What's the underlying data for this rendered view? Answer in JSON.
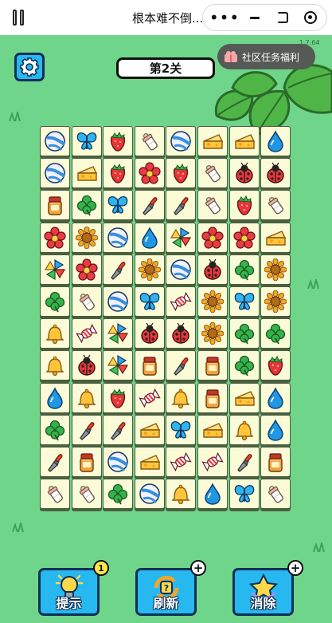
{
  "app": {
    "title": "根本难不倒..."
  },
  "capsule": {
    "more": "•••"
  },
  "version": "1.7.64",
  "header": {
    "level": "第2关",
    "community": "社区任务福利"
  },
  "board": {
    "rows": [
      [
        "beach-ball",
        "butterfly",
        "strawberry",
        "baby-bottle",
        "beach-ball",
        "cheese",
        "cheese",
        "water-drop"
      ],
      [
        "beach-ball",
        "cheese",
        "strawberry",
        "red-flower",
        "strawberry",
        "baby-bottle",
        "ladybug",
        "ladybug"
      ],
      [
        "honey-jar",
        "clover",
        "butterfly",
        "trowel",
        "trowel",
        "baby-bottle",
        "strawberry",
        "baby-bottle"
      ],
      [
        "red-flower",
        "sunflower",
        "beach-ball",
        "water-drop",
        "pinwheel",
        "red-flower",
        "red-flower",
        "cheese"
      ],
      [
        "pinwheel",
        "red-flower",
        "trowel",
        "sunflower",
        "beach-ball",
        "ladybug",
        "clover",
        "sunflower"
      ],
      [
        "clover",
        "baby-bottle",
        "beach-ball",
        "butterfly",
        "candy",
        "sunflower",
        "butterfly",
        "sunflower"
      ],
      [
        "bell",
        "candy",
        "pinwheel",
        "ladybug",
        "ladybug",
        "sunflower",
        "clover",
        "clover"
      ],
      [
        "bell",
        "ladybug",
        "pinwheel",
        "honey-jar",
        "trowel",
        "honey-jar",
        "clover",
        "strawberry"
      ],
      [
        "water-drop",
        "bell",
        "strawberry",
        "candy",
        "bell",
        "honey-jar",
        "cheese",
        "water-drop"
      ],
      [
        "clover",
        "trowel",
        "trowel",
        "cheese",
        "butterfly",
        "cheese",
        "bell",
        "water-drop"
      ],
      [
        "trowel",
        "honey-jar",
        "beach-ball",
        "cheese",
        "candy",
        "candy",
        "trowel",
        "honey-jar"
      ],
      [
        "baby-bottle",
        "baby-bottle",
        "clover",
        "beach-ball",
        "bell",
        "water-drop",
        "butterfly",
        "baby-bottle"
      ]
    ]
  },
  "tools": {
    "hint": {
      "label": "提示",
      "count": "1",
      "icon": "lightbulb-icon"
    },
    "refresh": {
      "label": "刷新",
      "plus": "+",
      "icon": "refresh-icon"
    },
    "eliminate": {
      "label": "消除",
      "plus": "+",
      "icon": "star-icon"
    }
  },
  "colors": {
    "background": "#6fd58a",
    "tile": "#fbfbd8",
    "button": "#27b8f0",
    "outline": "#0d2f56"
  }
}
